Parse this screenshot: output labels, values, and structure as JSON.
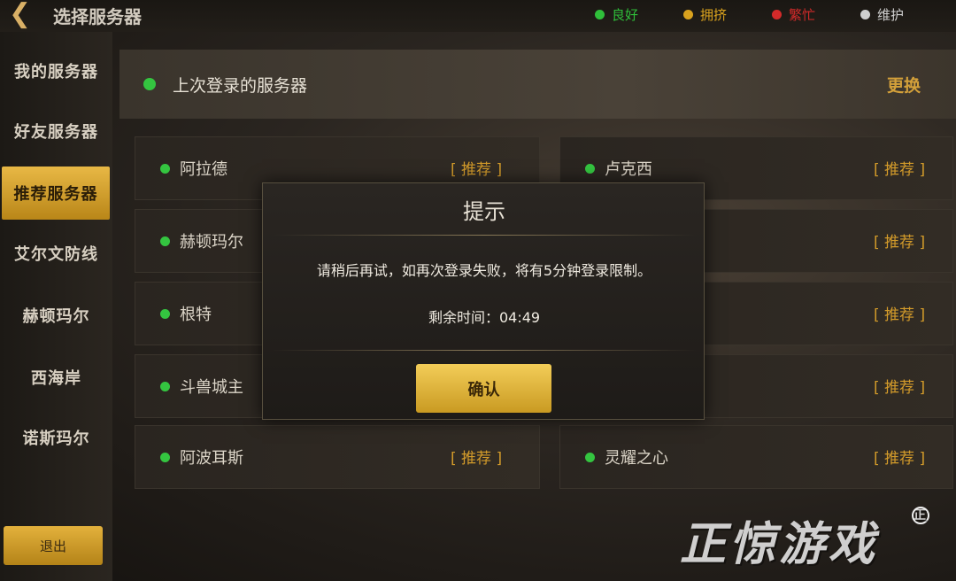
{
  "header": {
    "back_icon": "back-arrow-icon",
    "title": "选择服务器",
    "legend": [
      {
        "label": "良好",
        "color": "#2fbf3a"
      },
      {
        "label": "拥挤",
        "color": "#d9a21e"
      },
      {
        "label": "繁忙",
        "color": "#d42a2a"
      },
      {
        "label": "维护",
        "color": "#cfcfcf"
      }
    ]
  },
  "sidebar": {
    "items": [
      {
        "label": "我的服务器"
      },
      {
        "label": "好友服务器"
      },
      {
        "label": "推荐服务器"
      },
      {
        "label": "艾尔文防线"
      },
      {
        "label": "赫顿玛尔"
      },
      {
        "label": "西海岸"
      },
      {
        "label": "诺斯玛尔"
      }
    ],
    "active_index": 2,
    "exit_label": "退出"
  },
  "last_login": {
    "label": "上次登录的服务器",
    "action": "更换"
  },
  "servers": {
    "left": [
      {
        "name": "阿拉德",
        "tag": "[ 推荐 ]"
      },
      {
        "name": "赫顿玛尔",
        "tag": ""
      },
      {
        "name": "根特",
        "tag": ""
      },
      {
        "name": "斗兽城主",
        "tag": ""
      },
      {
        "name": "阿波耳斯",
        "tag": "[ 推荐 ]"
      }
    ],
    "right": [
      {
        "name": "卢克西",
        "tag": "[ 推荐 ]"
      },
      {
        "name": "",
        "tag": "[ 推荐 ]"
      },
      {
        "name": "",
        "tag": "[ 推荐 ]"
      },
      {
        "name": "",
        "tag": "[ 推荐 ]"
      },
      {
        "name": "灵耀之心",
        "tag": "[ 推荐 ]"
      }
    ]
  },
  "dialog": {
    "title": "提示",
    "message": "请稍后再试，如再次登录失败，将有5分钟登录限制。",
    "remain_label": "剩余时间：",
    "remain_time": "04:49",
    "confirm_label": "确认"
  },
  "watermark": {
    "text": "正惊游戏",
    "mark": "正"
  }
}
